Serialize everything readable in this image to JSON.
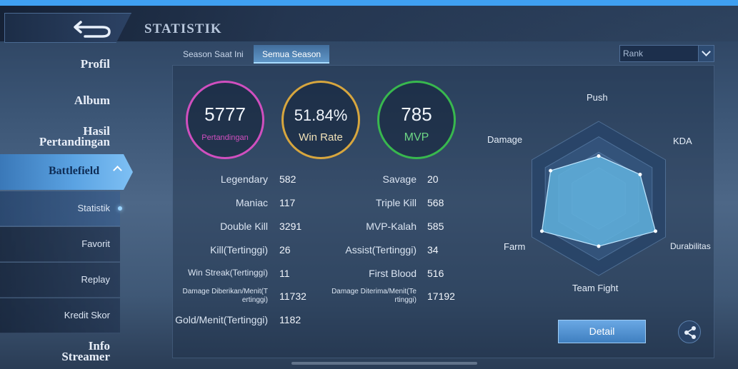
{
  "header": {
    "title": "STATISTIK"
  },
  "sidebar": {
    "profil": "Profil",
    "album": "Album",
    "hasil_line1": "Hasil",
    "hasil_line2": "Pertandingan",
    "battlefield": "Battlefield",
    "subitems": [
      "Statistik",
      "Favorit",
      "Replay",
      "Kredit Skor"
    ],
    "info_line1": "Info",
    "info_line2": "Streamer"
  },
  "tabs": [
    "Season Saat Ini",
    "Semua Season"
  ],
  "mode_select": {
    "value": "Rank"
  },
  "summary": {
    "matches": {
      "value": "5777",
      "label": "Pertandingan",
      "color": "#d04fbf"
    },
    "winrate": {
      "value": "51.84%",
      "label": "Win Rate",
      "color": "#d7a63e"
    },
    "mvp": {
      "value": "785",
      "label": "MVP",
      "color": "#38b84e"
    }
  },
  "stats_left": [
    {
      "label": "Legendary",
      "value": "582"
    },
    {
      "label": "Maniac",
      "value": "117"
    },
    {
      "label": "Double Kill",
      "value": "3291"
    },
    {
      "label": "Kill(Tertinggi)",
      "value": "26"
    },
    {
      "label": "Win Streak(Tertinggi)",
      "value": "11"
    },
    {
      "label_1": "Damage Diberikan/Menit(T",
      "label_2": "ertinggi)",
      "value": "11732"
    },
    {
      "label": "Gold/Menit(Tertinggi)",
      "value": "1182"
    }
  ],
  "stats_right": [
    {
      "label": "Savage",
      "value": "20"
    },
    {
      "label": "Triple Kill",
      "value": "568"
    },
    {
      "label": "MVP-Kalah",
      "value": "585"
    },
    {
      "label": "Assist(Tertinggi)",
      "value": "34"
    },
    {
      "label": "First Blood",
      "value": "516"
    },
    {
      "label_1": "Damage Diterima/Menit(Te",
      "label_2": "rtinggi)",
      "value": "17192"
    }
  ],
  "radar": {
    "axes": [
      "Push",
      "KDA",
      "Durabilitas",
      "Team Fight",
      "Farm",
      "Damage"
    ],
    "values": [
      0.55,
      0.62,
      0.85,
      0.62,
      0.85,
      0.72
    ],
    "fill_color": "#5fb0dc"
  },
  "detail_button": "Detail",
  "icons": {
    "back": "back-arrow-icon",
    "share": "share-icon",
    "dropdown": "chevron-down-icon"
  }
}
